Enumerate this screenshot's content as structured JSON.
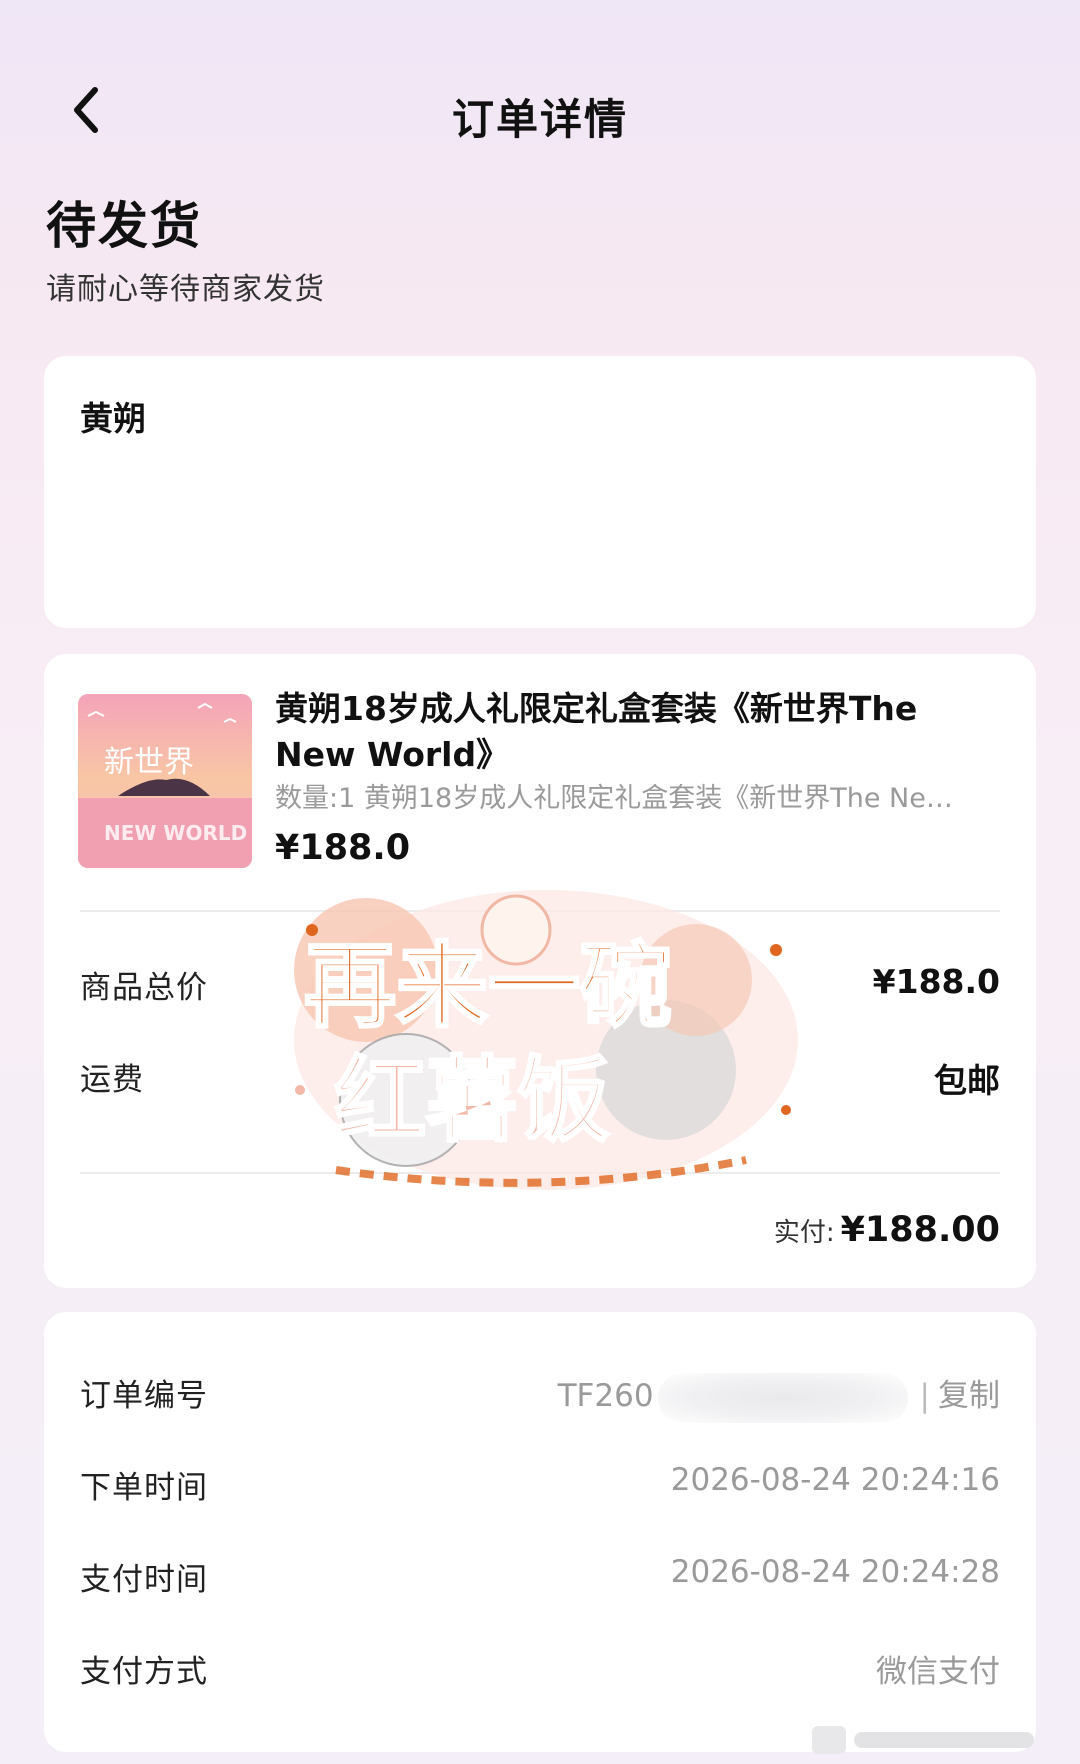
{
  "nav": {
    "title": "订单详情",
    "back_icon": "chevron-left-icon"
  },
  "status": {
    "title": "待发货",
    "subtitle": "请耐心等待商家发货"
  },
  "address": {
    "name": "黄朔"
  },
  "product": {
    "title": "黄朔18岁成人礼限定礼盒套装《新世界The New World》",
    "spec": "数量:1 黄朔18岁成人礼限定礼盒套装《新世界The Ne…",
    "price": "¥188.0",
    "thumb_text": "新世界",
    "thumb_sub": "NEW WORLD"
  },
  "summary": {
    "subtotal_label": "商品总价",
    "subtotal_value": "¥188.0",
    "shipping_label": "运费",
    "shipping_value": "包邮",
    "paid_label": "实付:",
    "paid_value": "¥188.00"
  },
  "sticker": {
    "line1": "再来一碗",
    "line2": "红薯饭"
  },
  "order": {
    "number_label": "订单编号",
    "number_prefix": "TF260",
    "copy_label": "复制",
    "order_time_label": "下单时间",
    "order_time_value": "2026-08-24 20:24:16",
    "pay_time_label": "支付时间",
    "pay_time_value": "2026-08-24 20:24:28",
    "pay_method_label": "支付方式",
    "pay_method_value": "微信支付"
  },
  "colors": {
    "sticker_orange": "#e0661f",
    "sticker_pink": "#f3b8a8",
    "muted_text": "#9a9a9a"
  }
}
